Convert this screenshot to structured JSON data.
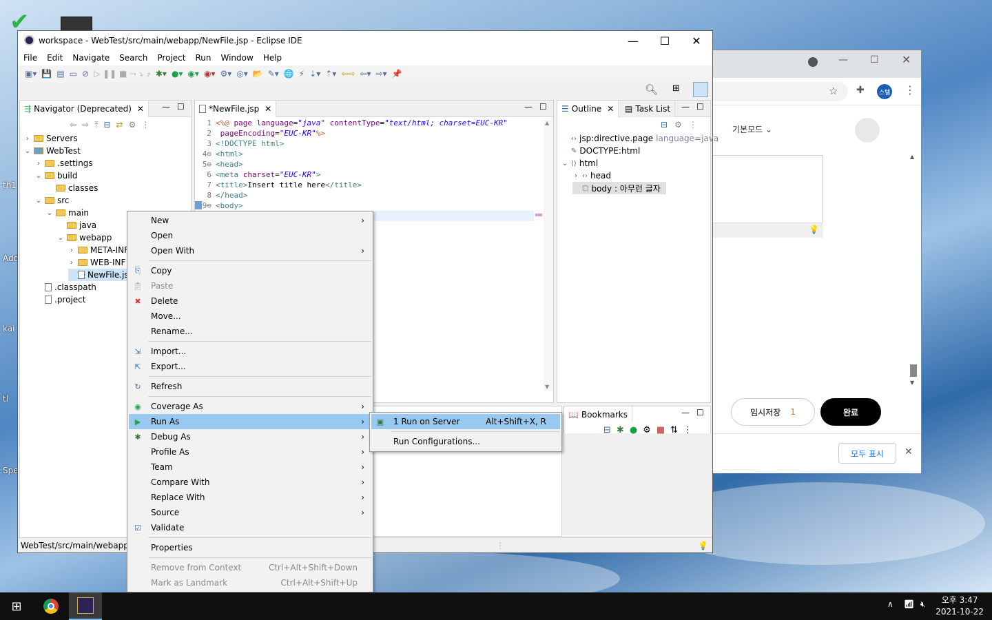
{
  "desktop": {
    "icons": [
      "th1",
      "Add",
      "kai",
      "tl",
      "Spe"
    ]
  },
  "eclipse": {
    "title": "workspace - WebTest/src/main/webapp/NewFile.jsp - Eclipse IDE",
    "menus": [
      "File",
      "Edit",
      "Navigate",
      "Search",
      "Project",
      "Run",
      "Window",
      "Help"
    ],
    "navigator": {
      "tab": "Navigator (Deprecated)",
      "tree": [
        {
          "label": "Servers",
          "depth": 0,
          "arrow": "›",
          "type": "folder-special"
        },
        {
          "label": "WebTest",
          "depth": 0,
          "arrow": "⌄",
          "type": "project"
        },
        {
          "label": ".settings",
          "depth": 1,
          "arrow": "›",
          "type": "folder"
        },
        {
          "label": "build",
          "depth": 1,
          "arrow": "⌄",
          "type": "folder"
        },
        {
          "label": "classes",
          "depth": 2,
          "arrow": "",
          "type": "folder"
        },
        {
          "label": "src",
          "depth": 1,
          "arrow": "⌄",
          "type": "folder"
        },
        {
          "label": "main",
          "depth": 2,
          "arrow": "⌄",
          "type": "folder"
        },
        {
          "label": "java",
          "depth": 3,
          "arrow": "",
          "type": "folder"
        },
        {
          "label": "webapp",
          "depth": 3,
          "arrow": "⌄",
          "type": "folder"
        },
        {
          "label": "META-INF",
          "depth": 4,
          "arrow": "›",
          "type": "folder"
        },
        {
          "label": "WEB-INF",
          "depth": 4,
          "arrow": "›",
          "type": "folder"
        },
        {
          "label": "NewFile.js",
          "depth": 4,
          "arrow": "",
          "type": "file"
        },
        {
          "label": ".classpath",
          "depth": 1,
          "arrow": "",
          "type": "xfile"
        },
        {
          "label": ".project",
          "depth": 1,
          "arrow": "",
          "type": "xfile"
        }
      ]
    },
    "editor": {
      "tab": "*NewFile.jsp",
      "lines": [
        {
          "n": "1",
          "html": "<span class='kw'>&lt;%@</span> <span class='attr'>page</span> <span class='attr'>language</span>=<span class='val'>\"java\"</span> <span class='attr'>contentType</span>=<span class='val'>\"text/html; charset=EUC-KR\"</span>"
        },
        {
          "n": "2",
          "html": "    <span class='attr'>pageEncoding</span>=<span class='val'>\"EUC-KR\"</span><span class='kw'>%&gt;</span>"
        },
        {
          "n": "3",
          "html": "<span class='tag'>&lt;!DOCTYPE html&gt;</span>"
        },
        {
          "n": "4⊖",
          "html": "<span class='tag'>&lt;html&gt;</span>"
        },
        {
          "n": "5⊖",
          "html": "<span class='tag'>&lt;head&gt;</span>"
        },
        {
          "n": "6",
          "html": "<span class='tag'>&lt;meta</span> <span class='attr'>charset</span>=<span class='val'>\"EUC-KR\"</span><span class='tag'>&gt;</span>"
        },
        {
          "n": "7",
          "html": "<span class='tag'>&lt;title&gt;</span>Insert title here<span class='tag'>&lt;/title&gt;</span>"
        },
        {
          "n": "8",
          "html": "<span class='tag'>&lt;/head&gt;</span>"
        },
        {
          "n": "9⊖",
          "html": "<span class='tag'>&lt;body&gt;</span>"
        }
      ]
    },
    "outline": {
      "tabs": [
        "Outline",
        "Task List"
      ],
      "items": [
        {
          "label": "jsp:directive.page",
          "extra": "language=java",
          "depth": 0
        },
        {
          "label": "DOCTYPE:html",
          "extra": "",
          "depth": 0
        },
        {
          "label": "html",
          "extra": "",
          "depth": 0
        },
        {
          "label": "head",
          "extra": "",
          "depth": 1
        },
        {
          "label": "body : 아무런 글자",
          "extra": "",
          "depth": 1
        }
      ]
    },
    "bookmarks_tab": "Bookmarks",
    "status": "WebTest/src/main/webapp/N"
  },
  "context_menu": [
    {
      "label": "New",
      "sub": true
    },
    {
      "label": "Open"
    },
    {
      "label": "Open With",
      "sub": true
    },
    {
      "sep": true
    },
    {
      "label": "Copy",
      "icon": "copy"
    },
    {
      "label": "Paste",
      "icon": "paste",
      "disabled": true
    },
    {
      "label": "Delete",
      "icon": "delete"
    },
    {
      "label": "Move..."
    },
    {
      "label": "Rename..."
    },
    {
      "sep": true
    },
    {
      "label": "Import...",
      "icon": "import"
    },
    {
      "label": "Export...",
      "icon": "export"
    },
    {
      "sep": true
    },
    {
      "label": "Refresh",
      "icon": "refresh"
    },
    {
      "sep": true
    },
    {
      "label": "Coverage As",
      "icon": "coverage",
      "sub": true
    },
    {
      "label": "Run As",
      "icon": "run",
      "sub": true,
      "highlight": true
    },
    {
      "label": "Debug As",
      "icon": "debug",
      "sub": true
    },
    {
      "label": "Profile As",
      "sub": true
    },
    {
      "label": "Team",
      "sub": true
    },
    {
      "label": "Compare With",
      "sub": true
    },
    {
      "label": "Replace With",
      "sub": true
    },
    {
      "label": "Source",
      "sub": true
    },
    {
      "label": "Validate",
      "icon": "check"
    },
    {
      "sep": true
    },
    {
      "label": "Properties"
    },
    {
      "sep": true
    },
    {
      "label": "Remove from Context",
      "shortcut": "Ctrl+Alt+Shift+Down",
      "disabled": true
    },
    {
      "label": "Mark as Landmark",
      "shortcut": "Ctrl+Alt+Shift+Up",
      "disabled": true
    }
  ],
  "submenu": [
    {
      "label": "1 Run on Server",
      "shortcut": "Alt+Shift+X, R",
      "highlight": true
    },
    {
      "sep": true
    },
    {
      "label": "Run Configurations..."
    }
  ],
  "chrome": {
    "mode": "기본모드",
    "draft_label": "임시저장",
    "draft_count": "1",
    "done": "완료",
    "show_all": "모두 표시",
    "profile": "스텔"
  },
  "taskbar": {
    "time": "오후 3:47",
    "date": "2021-10-22"
  },
  "colors": {
    "highlight": "#99c9ef",
    "run": "#1aa34a"
  }
}
